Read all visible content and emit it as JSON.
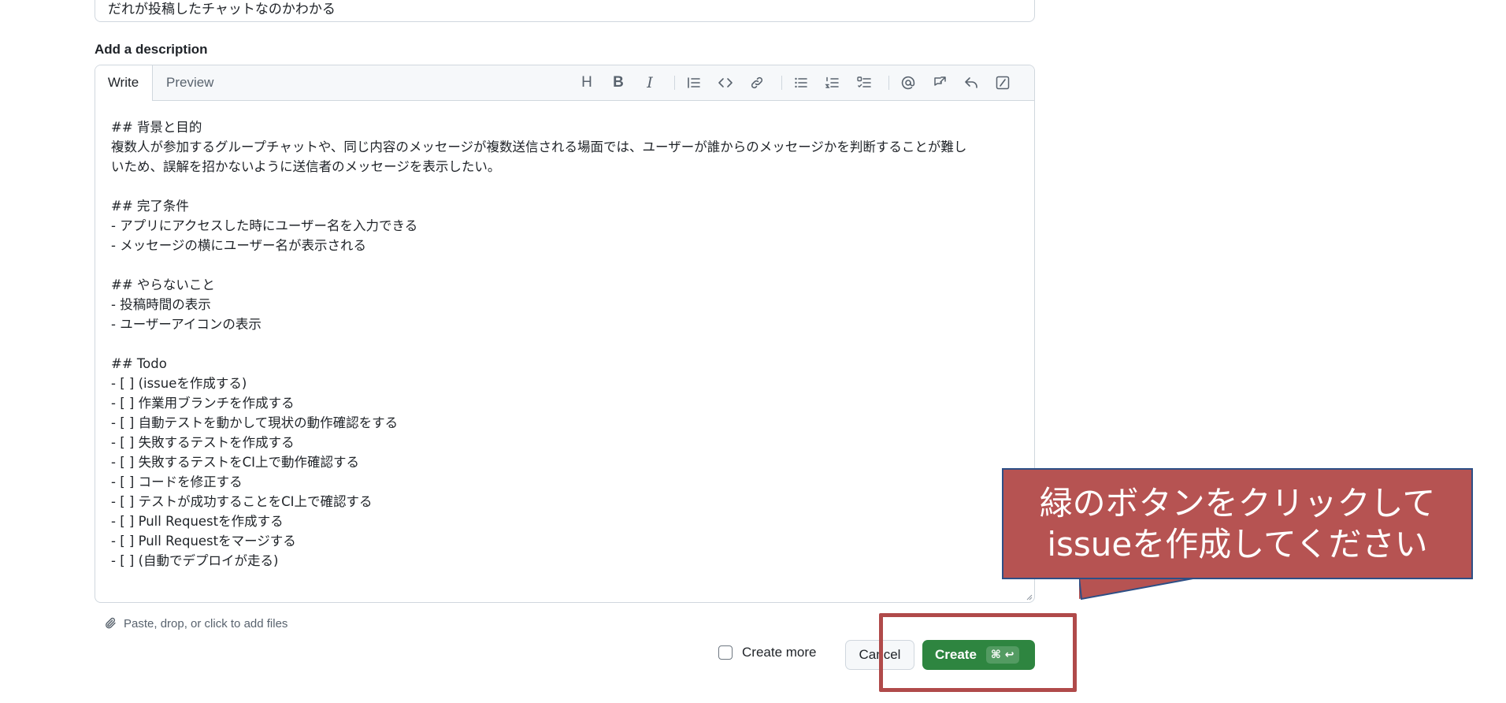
{
  "title_field": {
    "value": "だれが投稿したチャットなのかわかる"
  },
  "description": {
    "label": "Add a description",
    "tabs": [
      {
        "label": "Write",
        "active": true
      },
      {
        "label": "Preview",
        "active": false
      }
    ],
    "toolbar_icons": [
      "heading-icon",
      "bold-icon",
      "italic-icon",
      "quote-icon",
      "code-icon",
      "link-icon",
      "unordered-list-icon",
      "ordered-list-icon",
      "task-list-icon",
      "mention-icon",
      "cross-reference-icon",
      "reply-icon",
      "slash-command-icon"
    ],
    "body": "## 背景と目的\n複数人が参加するグループチャットや、同じ内容のメッセージが複数送信される場面では、ユーザーが誰からのメッセージかを判断することが難し\nいため、誤解を招かないように送信者のメッセージを表示したい。\n\n## 完了条件\n- アプリにアクセスした時にユーザー名を入力できる\n- メッセージの横にユーザー名が表示される\n\n## やらないこと\n- 投稿時間の表示\n- ユーザーアイコンの表示\n\n## Todo\n- [ ] (issueを作成する)\n- [ ] 作業用ブランチを作成する\n- [ ] 自動テストを動かして現状の動作確認をする\n- [ ] 失敗するテストを作成する\n- [ ] 失敗するテストをCI上で動作確認する\n- [ ] コードを修正する\n- [ ] テストが成功することをCI上で確認する\n- [ ] Pull Requestを作成する\n- [ ] Pull Requestをマージする\n- [ ] (自動でデプロイが走る)"
  },
  "attach": {
    "label": "Paste, drop, or click to add files",
    "icon": "paperclip-icon"
  },
  "footer": {
    "create_more_label": "Create more",
    "create_more_checked": false,
    "cancel_label": "Cancel",
    "create_label": "Create",
    "create_shortcut": "⌘ ↩",
    "create_color": "#2e8540"
  },
  "annotation": {
    "callout_line1": "緑のボタンをクリックして",
    "callout_line2": "issueを作成してください",
    "callout_color": "#b65352",
    "highlight_color": "#b04a4a"
  }
}
